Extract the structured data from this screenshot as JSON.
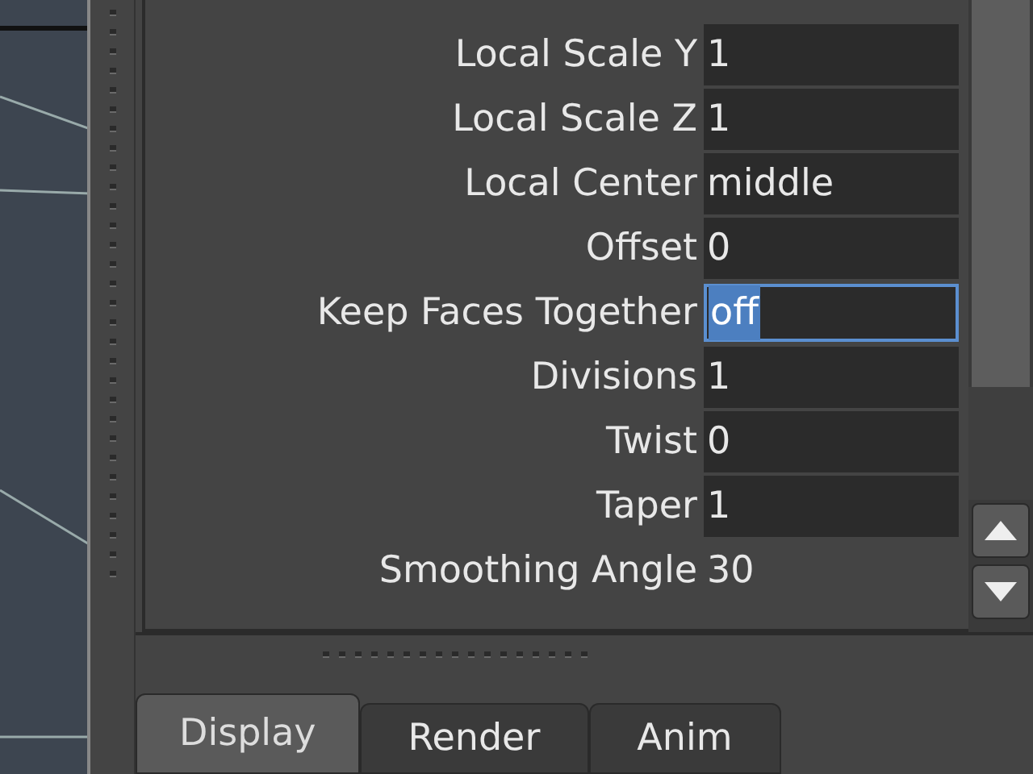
{
  "attributes": [
    {
      "label": "Local Scale Y",
      "value": "1",
      "kind": "field",
      "editing": false
    },
    {
      "label": "Local Scale Z",
      "value": "1",
      "kind": "field",
      "editing": false
    },
    {
      "label": "Local Center",
      "value": "middle",
      "kind": "field",
      "editing": false
    },
    {
      "label": "Offset",
      "value": "0",
      "kind": "field",
      "editing": false
    },
    {
      "label": "Keep Faces Together",
      "value": "off",
      "kind": "field",
      "editing": true
    },
    {
      "label": "Divisions",
      "value": "1",
      "kind": "field",
      "editing": false
    },
    {
      "label": "Twist",
      "value": "0",
      "kind": "field",
      "editing": false
    },
    {
      "label": "Taper",
      "value": "1",
      "kind": "field",
      "editing": false
    },
    {
      "label": "Smoothing Angle",
      "value": "30",
      "kind": "plain",
      "editing": false
    }
  ],
  "tabs": [
    {
      "label": "Display",
      "selected": true
    },
    {
      "label": "Render",
      "selected": false
    },
    {
      "label": "Anim",
      "selected": false
    }
  ]
}
